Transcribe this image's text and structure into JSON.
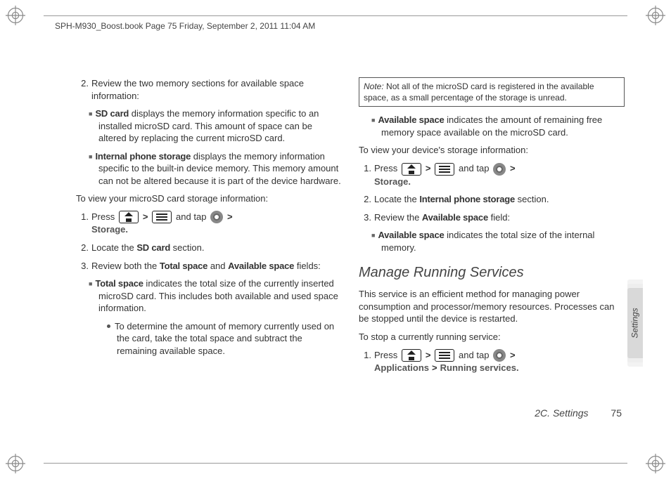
{
  "header": "SPH-M930_Boost.book  Page 75  Friday, September 2, 2011  11:04 AM",
  "sideTab": "Settings",
  "footer": {
    "section": "2C. Settings",
    "page": "75"
  },
  "left": {
    "step2": "Review the two memory sections for available space information:",
    "sd_label": "SD card",
    "sd_text": " displays the memory information specific to an installed microSD card. This amount of space can be altered by replacing the current microSD card.",
    "ips_label": "Internal phone storage",
    "ips_text": " displays the memory information specific to the built-in device memory. This memory amount can not be altered because it is part of the device hardware.",
    "lead1": "To view your microSD card storage information:",
    "press": "Press ",
    "and_tap": " and tap ",
    "storage_label": "Storage.",
    "step2b_a": "Locate the ",
    "sdcard_label": "SD card",
    "step2b_b": " section.",
    "step3_a": "Review both the ",
    "total_label": "Total space",
    "step3_b": " and ",
    "avail_label": "Available space",
    "step3_c": " fields:",
    "total_bullet_label": "Total space",
    "total_bullet_text": " indicates the total size of the currently inserted microSD card. This includes both available and used space information.",
    "subbullet": "To determine the amount of memory currently used on the card, take the total space and subtract the remaining available space."
  },
  "right": {
    "note_label": "Note:",
    "note_text": " Not all of the microSD card is registered in the available space, as a small percentage of the storage is unread.",
    "avail_label": "Available space",
    "avail_text": " indicates the amount of remaining free memory space available on the microSD card.",
    "lead2": "To view your device's storage information:",
    "press": "Press ",
    "and_tap": " and tap ",
    "storage_label": "Storage.",
    "step2_a": "Locate the ",
    "ips_label": "Internal phone storage",
    "step2_b": " section.",
    "step3_a": "Review the ",
    "avail_field": "Available space",
    "step3_b": " field:",
    "avail2_label": "Available space",
    "avail2_text": " indicates the total size of the internal memory.",
    "h2": "Manage Running Services",
    "para": "This service is an efficient method for managing power consumption and processor/memory resources. Processes can be stopped until the device is restarted.",
    "lead3": "To stop a currently running service:",
    "apps_label": "Applications",
    "rs_label": "Running services."
  }
}
